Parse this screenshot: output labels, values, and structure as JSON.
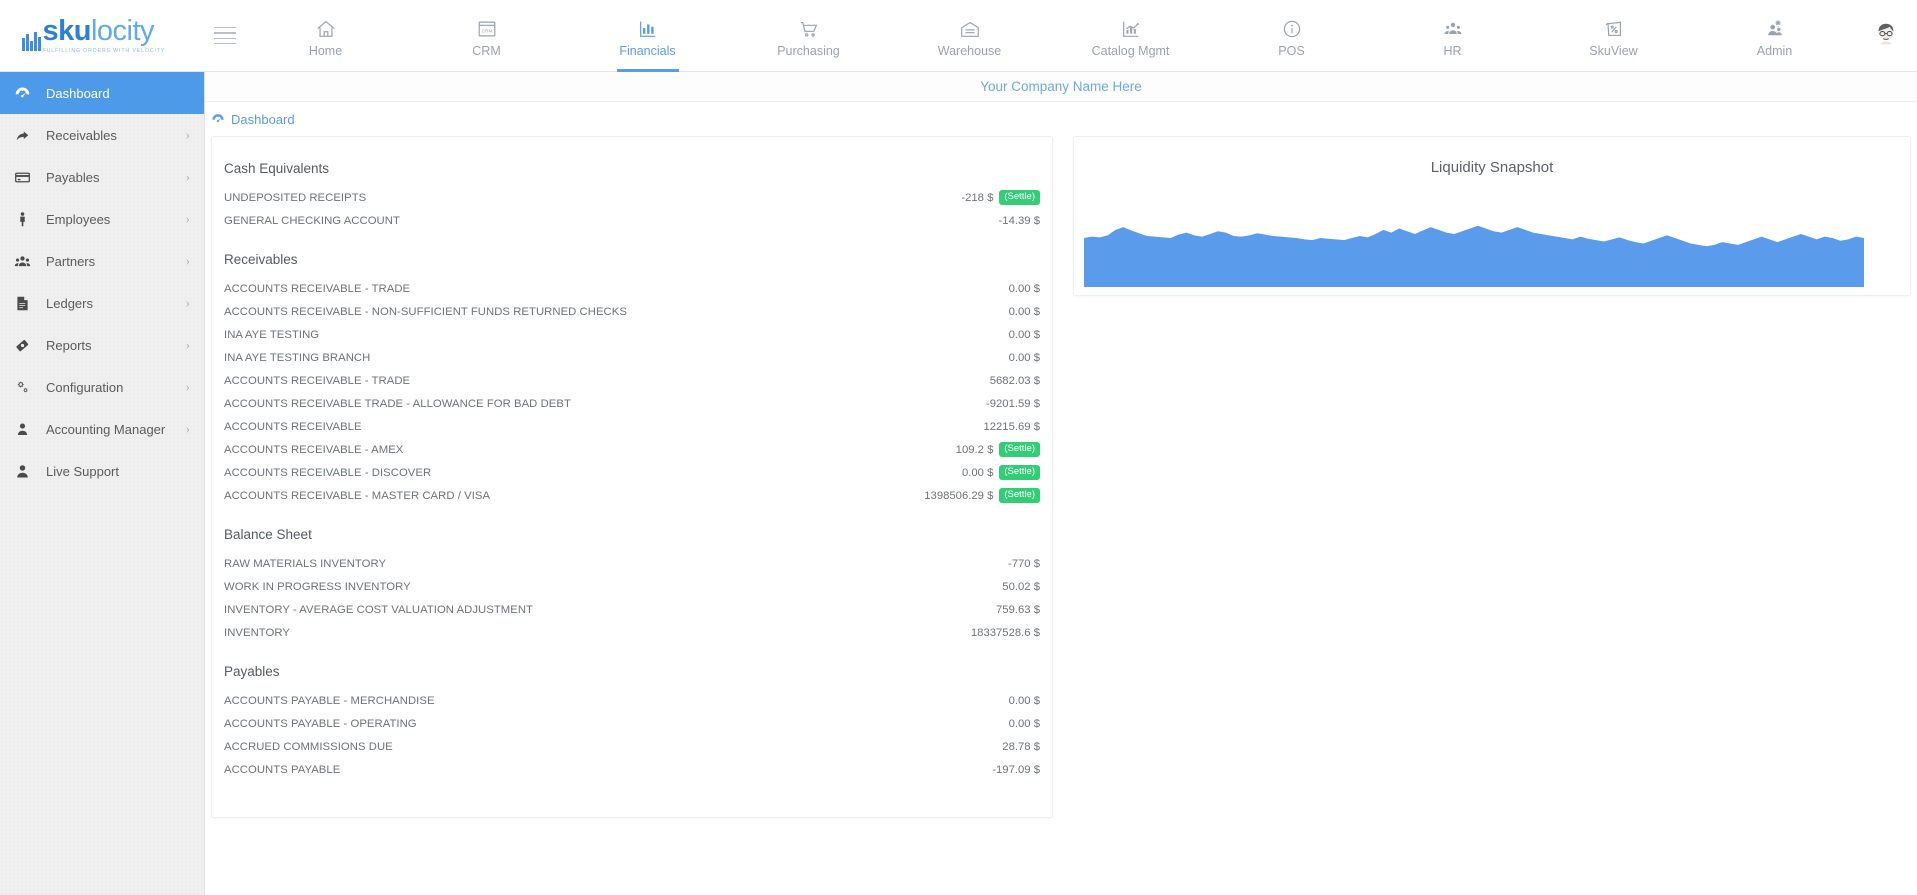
{
  "brand": {
    "name_bold": "sku",
    "name_light": "locity",
    "tagline": "FULFILLING ORDERS WITH VELOCITY"
  },
  "topnav": {
    "menu_toggle": "hamburger-menu",
    "items": [
      {
        "label": "Home",
        "icon": "home-icon",
        "active": false
      },
      {
        "label": "CRM",
        "icon": "crm-icon",
        "active": false
      },
      {
        "label": "Financials",
        "icon": "bar-chart-icon",
        "active": true
      },
      {
        "label": "Purchasing",
        "icon": "shopping-cart-icon",
        "active": false
      },
      {
        "label": "Warehouse",
        "icon": "warehouse-icon",
        "active": false
      },
      {
        "label": "Catalog Mgmt",
        "icon": "chart-trend-icon",
        "active": false
      },
      {
        "label": "POS",
        "icon": "info-circle-icon",
        "active": false
      },
      {
        "label": "HR",
        "icon": "people-group-icon",
        "active": false
      },
      {
        "label": "SkuView",
        "icon": "tag-percent-icon",
        "active": false
      },
      {
        "label": "Admin",
        "icon": "admin-users-gear-icon",
        "active": false
      }
    ],
    "avatar": "user-avatar"
  },
  "sidebar": {
    "items": [
      {
        "label": "Dashboard",
        "icon": "dashboard-gauge-icon",
        "active": true,
        "chevron": ""
      },
      {
        "label": "Receivables",
        "icon": "arrow-share-icon",
        "active": false,
        "chevron": "›"
      },
      {
        "label": "Payables",
        "icon": "credit-card-icon",
        "active": false,
        "chevron": "›"
      },
      {
        "label": "Employees",
        "icon": "person-icon",
        "active": false,
        "chevron": "›"
      },
      {
        "label": "Partners",
        "icon": "group-icon",
        "active": false,
        "chevron": "›"
      },
      {
        "label": "Ledgers",
        "icon": "document-icon",
        "active": false,
        "chevron": "›"
      },
      {
        "label": "Reports",
        "icon": "ribbon-icon",
        "active": false,
        "chevron": "›"
      },
      {
        "label": "Configuration",
        "icon": "gears-icon",
        "active": false,
        "chevron": "›"
      },
      {
        "label": "Accounting Manager",
        "icon": "user-icon",
        "active": false,
        "chevron": "›"
      },
      {
        "label": "Live Support",
        "icon": "user-solid-icon",
        "active": false,
        "chevron": ""
      }
    ]
  },
  "header": {
    "company_name": "Your Company Name Here",
    "breadcrumb": "Dashboard",
    "breadcrumb_icon": "dashboard-gauge-icon"
  },
  "colors": {
    "accent_blue": "#5b9bec",
    "sidebar_active": "#4d9ae8",
    "settle_green": "#33cd78",
    "chart_fill": "#5a9bec"
  },
  "settle_label": "(Settle)",
  "groups": [
    {
      "title": "Cash Equivalents",
      "rows": [
        {
          "name": "UNDEPOSITED RECEIPTS",
          "value": "-218 $",
          "settle": true
        },
        {
          "name": "GENERAL CHECKING ACCOUNT",
          "value": "-14.39 $",
          "settle": false
        }
      ]
    },
    {
      "title": "Receivables",
      "rows": [
        {
          "name": "ACCOUNTS RECEIVABLE - TRADE",
          "value": "0.00 $",
          "settle": false
        },
        {
          "name": "ACCOUNTS RECEIVABLE - NON-SUFFICIENT FUNDS RETURNED CHECKS",
          "value": "0.00 $",
          "settle": false
        },
        {
          "name": "INA AYE TESTING",
          "value": "0.00 $",
          "settle": false
        },
        {
          "name": "INA AYE TESTING BRANCH",
          "value": "0.00 $",
          "settle": false
        },
        {
          "name": "ACCOUNTS RECEIVABLE - TRADE",
          "value": "5682.03 $",
          "settle": false
        },
        {
          "name": "ACCOUNTS RECEIVABLE TRADE - ALLOWANCE FOR BAD DEBT",
          "value": "-9201.59 $",
          "settle": false
        },
        {
          "name": "ACCOUNTS RECEIVABLE",
          "value": "12215.69 $",
          "settle": false
        },
        {
          "name": "ACCOUNTS RECEIVABLE - AMEX",
          "value": "109.2 $",
          "settle": true
        },
        {
          "name": "ACCOUNTS RECEIVABLE - DISCOVER",
          "value": "0.00 $",
          "settle": true
        },
        {
          "name": "ACCOUNTS RECEIVABLE - MASTER CARD / VISA",
          "value": "1398506.29 $",
          "settle": true
        }
      ]
    },
    {
      "title": "Balance Sheet",
      "rows": [
        {
          "name": "RAW MATERIALS INVENTORY",
          "value": "-770 $",
          "settle": false
        },
        {
          "name": "WORK IN PROGRESS INVENTORY",
          "value": "50.02 $",
          "settle": false
        },
        {
          "name": "INVENTORY - AVERAGE COST VALUATION ADJUSTMENT",
          "value": "759.63 $",
          "settle": false
        },
        {
          "name": "INVENTORY",
          "value": "18337528.6 $",
          "settle": false
        }
      ]
    },
    {
      "title": "Payables",
      "rows": [
        {
          "name": "ACCOUNTS PAYABLE - MERCHANDISE",
          "value": "0.00 $",
          "settle": false
        },
        {
          "name": "ACCOUNTS PAYABLE - OPERATING",
          "value": "0.00 $",
          "settle": false
        },
        {
          "name": "ACCRUED COMMISSIONS DUE",
          "value": "28.78 $",
          "settle": false
        },
        {
          "name": "ACCOUNTS PAYABLE",
          "value": "-197.09 $",
          "settle": false
        }
      ]
    }
  ],
  "chart_data": {
    "type": "area",
    "title": "Liquidity Snapshot",
    "xlabel": "",
    "ylabel": "",
    "grid": false,
    "legend": "none",
    "axis_visible": false,
    "fill_color": "#5a9bec",
    "ylim": [
      0,
      100
    ],
    "x": [
      0,
      1,
      2,
      3,
      4,
      5,
      6,
      7,
      8,
      9,
      10,
      11,
      12,
      13,
      14,
      15,
      16,
      17,
      18,
      19,
      20,
      21,
      22,
      23,
      24,
      25,
      26,
      27,
      28,
      29,
      30,
      31,
      32,
      33,
      34,
      35,
      36,
      37,
      38,
      39,
      40,
      41,
      42,
      43,
      44,
      45,
      46,
      47,
      48,
      49,
      50,
      51,
      52,
      53,
      54,
      55,
      56,
      57,
      58,
      59,
      60,
      61,
      62,
      63,
      64,
      65,
      66,
      67,
      68,
      69,
      70,
      71,
      72,
      73,
      74,
      75,
      76,
      77,
      78,
      79,
      80,
      81,
      82,
      83,
      84,
      85,
      86,
      87,
      88,
      89,
      90,
      91,
      92,
      93,
      94,
      95,
      96,
      97,
      98,
      99
    ],
    "values": [
      72,
      74,
      73,
      76,
      84,
      88,
      83,
      79,
      75,
      74,
      73,
      72,
      77,
      80,
      76,
      74,
      78,
      82,
      80,
      75,
      74,
      76,
      79,
      77,
      75,
      74,
      73,
      72,
      70,
      69,
      72,
      71,
      70,
      69,
      72,
      75,
      73,
      78,
      84,
      80,
      86,
      82,
      78,
      83,
      88,
      84,
      80,
      78,
      82,
      86,
      90,
      86,
      82,
      80,
      84,
      88,
      84,
      80,
      78,
      76,
      74,
      72,
      70,
      74,
      71,
      69,
      67,
      70,
      73,
      69,
      66,
      64,
      68,
      72,
      76,
      72,
      68,
      64,
      62,
      60,
      62,
      66,
      64,
      62,
      66,
      70,
      74,
      70,
      66,
      70,
      74,
      78,
      74,
      70,
      74,
      72,
      68,
      70,
      74,
      72
    ]
  }
}
